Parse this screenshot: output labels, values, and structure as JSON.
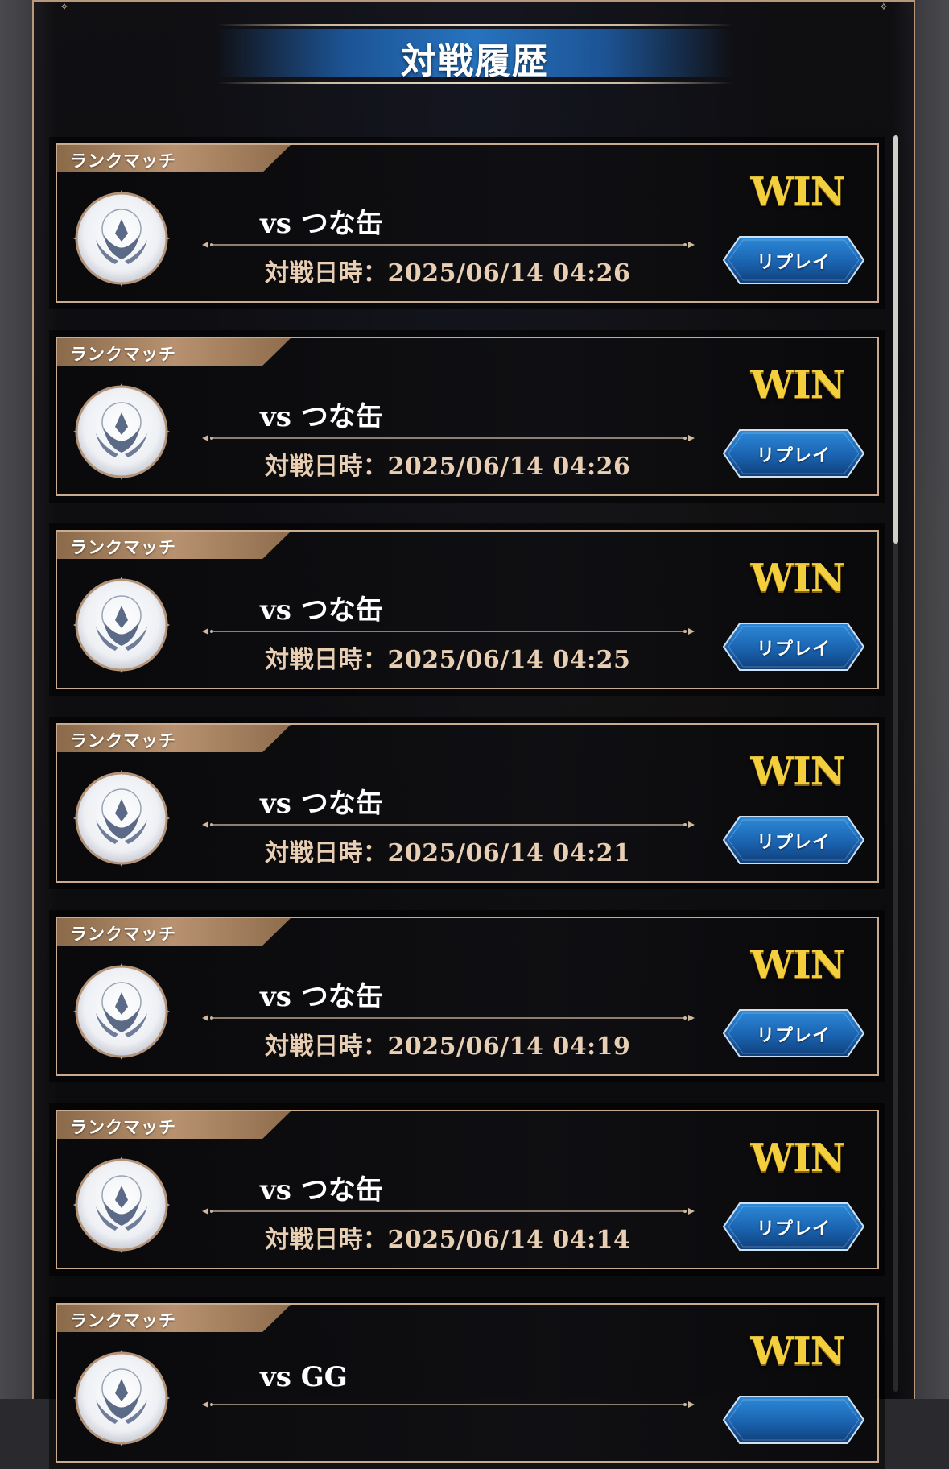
{
  "screen": {
    "title": "対戦履歴"
  },
  "colors": {
    "frame_border": "#c9ab90",
    "tag_bronze": "#b89270",
    "win_gold": "#f3cf3e",
    "replay_blue": "#1e73c8",
    "datetime_text": "#e8cfb4"
  },
  "scroll": {
    "position_fraction": 0.0,
    "thumb_fraction": 0.32
  },
  "matches": [
    {
      "mode": "ランクマッチ",
      "opponent": "vs つな缶",
      "datetime": "対戦日時：2025/06/14 04:26",
      "result": "WIN",
      "replay_label": "リプレイ",
      "emblem_icon": "crest-emblem-icon"
    },
    {
      "mode": "ランクマッチ",
      "opponent": "vs つな缶",
      "datetime": "対戦日時：2025/06/14 04:26",
      "result": "WIN",
      "replay_label": "リプレイ",
      "emblem_icon": "crest-emblem-icon"
    },
    {
      "mode": "ランクマッチ",
      "opponent": "vs つな缶",
      "datetime": "対戦日時：2025/06/14 04:25",
      "result": "WIN",
      "replay_label": "リプレイ",
      "emblem_icon": "crest-emblem-icon"
    },
    {
      "mode": "ランクマッチ",
      "opponent": "vs つな缶",
      "datetime": "対戦日時：2025/06/14 04:21",
      "result": "WIN",
      "replay_label": "リプレイ",
      "emblem_icon": "crest-emblem-icon"
    },
    {
      "mode": "ランクマッチ",
      "opponent": "vs つな缶",
      "datetime": "対戦日時：2025/06/14 04:19",
      "result": "WIN",
      "replay_label": "リプレイ",
      "emblem_icon": "crest-emblem-icon"
    },
    {
      "mode": "ランクマッチ",
      "opponent": "vs つな缶",
      "datetime": "対戦日時：2025/06/14 04:14",
      "result": "WIN",
      "replay_label": "リプレイ",
      "emblem_icon": "crest-emblem-icon"
    },
    {
      "mode": "ランクマッチ",
      "opponent": "vs GG",
      "datetime": "",
      "result": "WIN",
      "replay_label": "",
      "emblem_icon": "crest-emblem-icon"
    }
  ]
}
